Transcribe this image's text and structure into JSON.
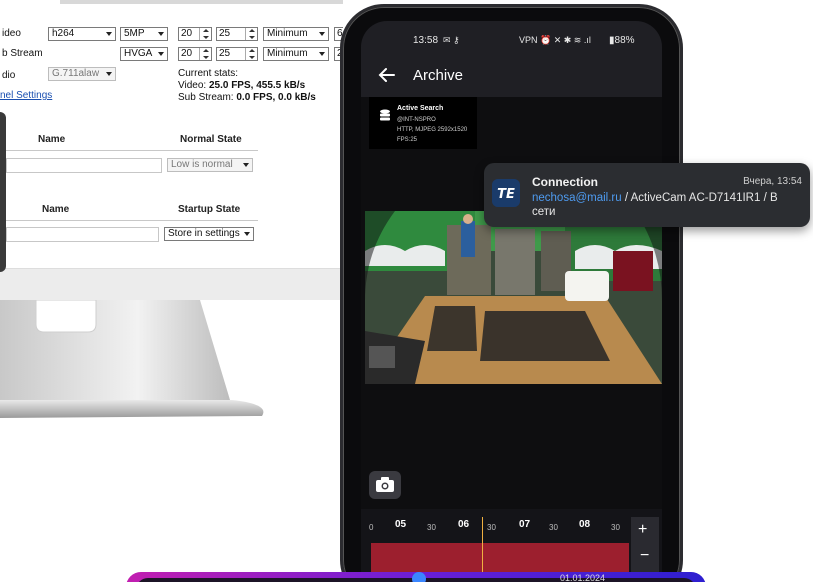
{
  "settings": {
    "rows": [
      {
        "label": "ideo",
        "codec": "h264",
        "resolution": "5MP",
        "fps": "20",
        "gop": "25",
        "quality": "Minimum",
        "extra": "6"
      },
      {
        "label": "b Stream",
        "codec": "",
        "resolution": "HVGA",
        "fps": "20",
        "gop": "25",
        "quality": "Minimum",
        "extra": "2"
      },
      {
        "label": "dio",
        "codec": "G.711alaw"
      }
    ],
    "link": "nel Settings",
    "stats_title": "Current stats:",
    "stats_video_prefix": "Video: ",
    "stats_video_value": "25.0 FPS, 455.5 kB/s",
    "stats_sub_prefix": "Sub Stream: ",
    "stats_sub_value": "0.0 FPS, 0.0 kB/s",
    "inputs_table": {
      "col_name": "Name",
      "col_state": "Normal State",
      "state_value": "Low is normal"
    },
    "outputs_table": {
      "col_name": "Name",
      "col_state": "Startup State",
      "state_value": "Store in settings"
    }
  },
  "phone": {
    "time": "13:58",
    "left_icons": "✉ ⚷",
    "right_icons": "VPN ⏰ ✕ ✱ ≋ .ıl",
    "battery": "88%",
    "title": "Archive",
    "info": {
      "title": "Active Search",
      "line1": "@INT-NSPRO",
      "line2": "HTTP, MJPEG 2592x1520",
      "line3": "FPS:25"
    },
    "timeline": {
      "major": [
        "05",
        "06",
        "07",
        "08"
      ],
      "minor": [
        "0",
        "30",
        "30",
        "30",
        "30"
      ],
      "cursor_fraction": 0.43
    },
    "zoom_in": "+",
    "zoom_out": "−"
  },
  "notification": {
    "title": "Connection",
    "time": "Вчера, 13:54",
    "email": "nechosa@mail.ru",
    "body_rest": " / ActiveCam AC-D7141IR1 / В сети"
  },
  "banner": {
    "text": "01.01.2024"
  }
}
